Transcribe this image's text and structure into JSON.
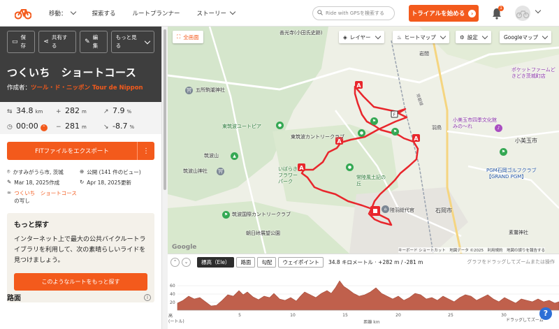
{
  "nav": {
    "items": [
      "移動：",
      "探索する",
      "ルートプランナー",
      "ストーリー"
    ],
    "search_placeholder": "Ride with GPSを検索する",
    "trial_label": "トライアルを始める",
    "notification_count": "1",
    "brand_color": "#f35a1c"
  },
  "hero": {
    "buttons": [
      {
        "label": "保存",
        "icon": "bookmark-icon"
      },
      {
        "label": "共有する",
        "icon": "share-icon"
      },
      {
        "label": "編集",
        "icon": "pencil-icon"
      },
      {
        "label": "もっと見る",
        "icon": "chevron-down-icon"
      }
    ],
    "title": "つくいち　ショートコース",
    "author_prefix": "作成者：",
    "author_name": "ツール・ド・ニッポン Tour de Nippon"
  },
  "stats": {
    "distance": {
      "value": "34.8",
      "unit": "km"
    },
    "elevation_gain": {
      "value": "282",
      "unit": "m"
    },
    "avg_grade": {
      "value": "7.9",
      "unit": "%"
    },
    "time": {
      "value": "00:00"
    },
    "elevation_loss": {
      "value": "281",
      "unit": "m"
    },
    "max_descent": {
      "value": "-8.7",
      "unit": "%"
    }
  },
  "export": {
    "label": "FITファイルをエクスポート",
    "more": "⋮"
  },
  "meta": {
    "location": "かすみがうら市, 茨城",
    "visibility": "公開 (141 件のビュー)",
    "created": "Mar 18, 2025作成",
    "updated": "Apr 18, 2025更新",
    "copy_of_link": "つくいち　ショートコース",
    "copy_of_suffix": "の写し"
  },
  "explore": {
    "heading": "もっと探す",
    "body": "インターネット上で最大の公共バイクルートライブラリを利用して、次の素晴らしいライドを見つけましょう。",
    "button": "このようなルートをもっと探す"
  },
  "route_heading": "路面",
  "map": {
    "fullscreen": "全画面",
    "controls": [
      "レイヤー",
      "ヒートマップ",
      "設定",
      "Googleマップ"
    ],
    "labels": [
      {
        "text": "善光寺(小田氏史跡)"
      },
      {
        "text": "岩間"
      },
      {
        "text": "五所駒瀧神社"
      },
      {
        "text": "東筑波ユートピア"
      },
      {
        "text": "東筑波カントリークラブ"
      },
      {
        "text": "筑波山"
      },
      {
        "text": "筑波山神社"
      },
      {
        "text": "いばらきフラワーパーク"
      },
      {
        "text": "常陸風土記の丘"
      },
      {
        "text": "筑波国際カントリークラブ"
      },
      {
        "text": "朝日峠展望公園"
      },
      {
        "text": "陸羽総代官"
      },
      {
        "text": "石岡市"
      },
      {
        "text": "小美玉市"
      },
      {
        "text": "小美玉市四季文化館 みの～れ"
      },
      {
        "text": "PGM石岡ゴルフクラブ【GRAND PGM】"
      },
      {
        "text": "ポケットファームどきどき茨城町店"
      },
      {
        "text": "羽鳥"
      },
      {
        "text": "素鵞神社"
      },
      {
        "text": "常磐線"
      }
    ],
    "attribution": "キーボード ショートカット　地図データ ©2025　利用規約　地図の誤りを報告する",
    "google": "Google",
    "route_color": "#e8262c"
  },
  "elevation": {
    "tabs": [
      "標高（Ele）",
      "路面",
      "勾配",
      "ウェイポイント"
    ],
    "summary": "34.8 キロメートル · +282 m / -281 m",
    "hint": "グラフをドラッグしてズームまたは操作",
    "y_label": "高",
    "y_unit": "(ートル)",
    "x_label": "距離 km",
    "drag_hint": "ドラッグしてズーム",
    "yticks": [
      "60",
      "40",
      "20"
    ],
    "xticks": [
      "5",
      "10",
      "15",
      "20",
      "25",
      "30"
    ],
    "fill_color": "#c0604c"
  }
}
